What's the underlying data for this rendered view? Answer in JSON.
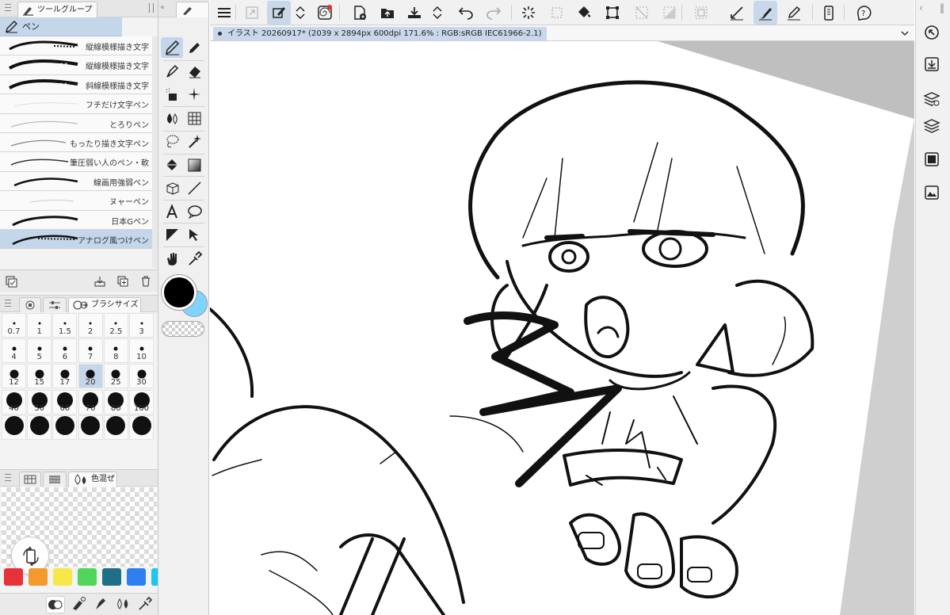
{
  "tool_group": {
    "tab_label": "ツールグループ",
    "selected_label": "ペン"
  },
  "brushes": [
    {
      "label": "縦線模様描き文字",
      "selected": false
    },
    {
      "label": "縦線模様描き文字",
      "selected": false
    },
    {
      "label": "斜線模様描き文字",
      "selected": false
    },
    {
      "label": "フチだけ文字ペン",
      "selected": false
    },
    {
      "label": "とろりペン",
      "selected": false
    },
    {
      "label": "もったり描き文字ペン",
      "selected": false
    },
    {
      "label": "筆圧弱い人のペン・軟",
      "selected": false
    },
    {
      "label": "線画用強弱ペン",
      "selected": false
    },
    {
      "label": "ヌャーペン",
      "selected": false
    },
    {
      "label": "日本Gペン",
      "selected": false
    },
    {
      "label": "アナログ風つけペン",
      "selected": true
    }
  ],
  "brush_size": {
    "tab_label": "ブラシサイズ",
    "selected": "20",
    "sizes": [
      "0.7",
      "1",
      "1.5",
      "2",
      "2.5",
      "3",
      "4",
      "5",
      "6",
      "7",
      "8",
      "10",
      "12",
      "15",
      "17",
      "20",
      "25",
      "30",
      "40",
      "50",
      "60",
      "70",
      "80",
      "100",
      "",
      "",
      "",
      "",
      "",
      ""
    ]
  },
  "color_mix": {
    "tab_label": "色混ぜ"
  },
  "swatches": [
    "#e8323a",
    "#f39a2e",
    "#f7e84a",
    "#4fd65a",
    "#1f6f86",
    "#2f7ff0",
    "#1ec6f0"
  ],
  "colors": {
    "main": "#000000",
    "sub": "#7fd4ff",
    "accent": "#c8d8ea"
  },
  "document": {
    "tab_title": "イラスト 20260917* (2039 x 2894px 600dpi 171.6% : RGB:sRGB IEC61966-2.1)"
  },
  "icons": {
    "top_bar": [
      "menu-icon",
      "fullscreen-icon",
      "selection-edit-icon",
      "up-down-icon",
      "spiral-icon",
      "new-file-icon",
      "open-folder-icon",
      "save-icon",
      "up-down-icon",
      "undo-icon",
      "redo-icon",
      "loading-icon",
      "selection-icon",
      "fill-icon",
      "crop-icon",
      "clear-selection-icon",
      "invert-icon",
      "border-icon",
      "line-icon",
      "brush-icon",
      "pen-icon",
      "device-icon",
      "help-icon"
    ],
    "right_bar": [
      "quick-access-icon",
      "import-icon",
      "layer-properties-icon",
      "layers-icon",
      "navigator-icon",
      "image-icon"
    ]
  }
}
